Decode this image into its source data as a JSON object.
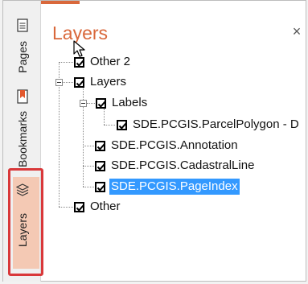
{
  "rail": {
    "tabs": [
      {
        "label": "Pages"
      },
      {
        "label": "Bookmarks"
      },
      {
        "label": "Layers",
        "active": true
      }
    ]
  },
  "panel": {
    "title": "Layers",
    "close_label": "×"
  },
  "tree": {
    "other2": {
      "label": "Other 2",
      "checked": true
    },
    "layers": {
      "label": "Layers",
      "checked": true
    },
    "labels": {
      "label": "Labels",
      "checked": true
    },
    "parcel_polygon": {
      "label": "SDE.PCGIS.ParcelPolygon - D",
      "checked": true
    },
    "annotation": {
      "label": "SDE.PCGIS.Annotation",
      "checked": true
    },
    "cadastral_line": {
      "label": "SDE.PCGIS.CadastralLine",
      "checked": true
    },
    "page_index": {
      "label": "SDE.PCGIS.PageIndex",
      "checked": true,
      "selected": true
    },
    "other": {
      "label": "Other",
      "checked": true
    }
  },
  "colors": {
    "accent": "#d9683b",
    "selection": "#3399ff",
    "callout": "#d9383a",
    "active_tab": "#f4c9b4"
  }
}
